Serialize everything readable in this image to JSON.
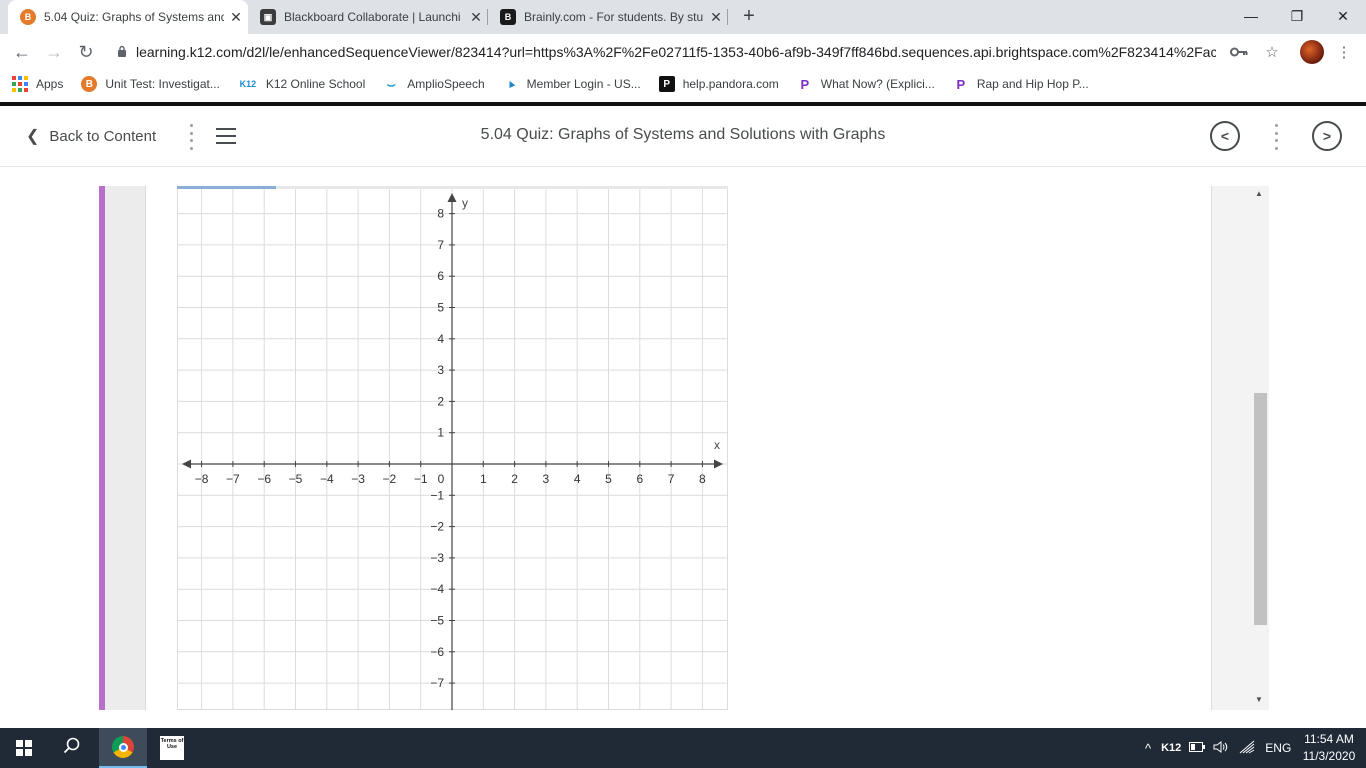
{
  "browser": {
    "tabs": [
      {
        "title": "5.04 Quiz: Graphs of Systems and",
        "favicon_color": "#e37b2b",
        "favicon_letter": "B",
        "active": true
      },
      {
        "title": "Blackboard Collaborate | Launchi",
        "favicon_color": "#3c3c3c",
        "favicon_letter": "▣",
        "active": false
      },
      {
        "title": "Brainly.com - For students. By stu",
        "favicon_color": "#1a1a1a",
        "favicon_letter": "B",
        "active": false
      }
    ],
    "new_tab_label": "+",
    "window_controls": {
      "minimize": "—",
      "restore": "❐",
      "close": "✕"
    },
    "url": "learning.k12.com/d2l/le/enhancedSequenceViewer/823414?url=https%3A%2F%2Fe02711f5-1353-40b6-af9b-349f7ff846bd.sequences.api.brightspace.com%2F823414%2Fac...",
    "nav": {
      "back": "←",
      "forward": "→",
      "reload": "↻"
    },
    "icons": {
      "lock": "lock-icon",
      "key": "key-icon",
      "star": "star-icon",
      "menu": "kebab-menu-icon"
    },
    "bookmarks": [
      {
        "label": "Apps",
        "icon": "apps-grid-icon"
      },
      {
        "label": "Unit Test: Investigat...",
        "icon": "brainly-icon",
        "icon_text": "B",
        "icon_color": "#e37b2b"
      },
      {
        "label": "K12 Online School",
        "icon": "k12-icon",
        "icon_text": "K12",
        "icon_color": "#1f8bd6"
      },
      {
        "label": "AmplioSpeech",
        "icon": "amplio-icon",
        "icon_text": "⌣",
        "icon_color": "#2aa3d8"
      },
      {
        "label": "Member Login - US...",
        "icon": "cursor-icon",
        "icon_text": "▲",
        "icon_color": "#1e88c8"
      },
      {
        "label": "help.pandora.com",
        "icon": "pandora-icon",
        "icon_text": "P",
        "icon_color": "#111111"
      },
      {
        "label": "What Now? (Explici...",
        "icon": "pandora-icon",
        "icon_text": "P",
        "icon_color": "#7b2fbe"
      },
      {
        "label": "Rap and Hip Hop P...",
        "icon": "pandora-icon",
        "icon_text": "P",
        "icon_color": "#7b2fbe"
      }
    ]
  },
  "header": {
    "back_label": "Back to Content",
    "title": "5.04 Quiz: Graphs of Systems and Solutions with Graphs",
    "prev_symbol": "<",
    "next_symbol": ">"
  },
  "content": {
    "accent_color": "#b86fcb",
    "graph_progress": 0.18,
    "scroll_up": "▲",
    "scroll_down": "▼"
  },
  "chart_data": {
    "type": "scatter",
    "xlabel": "x",
    "ylabel": "y",
    "xlim": [
      -8.5,
      8.5
    ],
    "ylim": [
      -7.5,
      8.5
    ],
    "grid": true,
    "x_ticks": [
      -8,
      -7,
      -6,
      -5,
      -4,
      -3,
      -2,
      -1,
      0,
      1,
      2,
      3,
      4,
      5,
      6,
      7,
      8
    ],
    "y_ticks": [
      -7,
      -6,
      -5,
      -4,
      -3,
      -2,
      -1,
      1,
      2,
      3,
      4,
      5,
      6,
      7,
      8
    ],
    "x_tick_labels": [
      "−8",
      "−7",
      "−6",
      "−5",
      "−4",
      "−3",
      "−2",
      "−1",
      "0",
      "1",
      "2",
      "3",
      "4",
      "5",
      "6",
      "7",
      "8"
    ],
    "y_tick_labels": [
      "−7",
      "−6",
      "−5",
      "−4",
      "−3",
      "−2",
      "−1",
      "1",
      "2",
      "3",
      "4",
      "5",
      "6",
      "7",
      "8"
    ],
    "series": []
  },
  "taskbar": {
    "search_icon": "⌕",
    "terms_label": "Terms of Use",
    "tray": {
      "chevron": "^",
      "k12": "K12",
      "lang": "ENG"
    },
    "time": "11:54 AM",
    "date": "11/3/2020"
  }
}
